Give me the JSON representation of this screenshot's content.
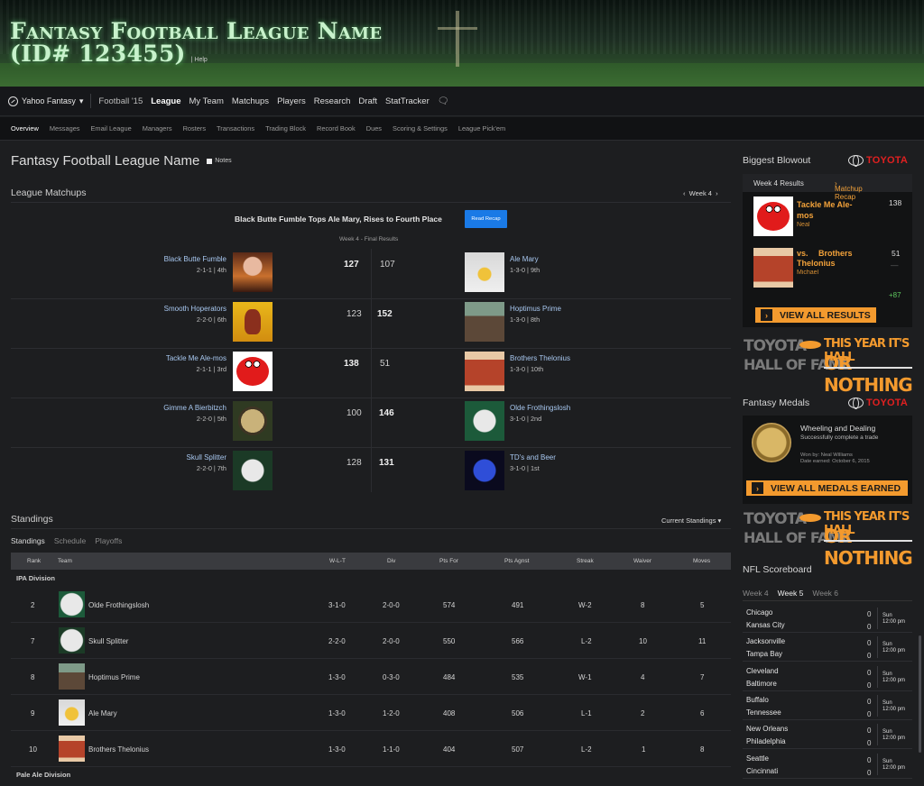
{
  "header": {
    "title_line1": "Fantasy Football League Name",
    "title_line2": "(ID# 123455)",
    "help": "Help"
  },
  "nav": {
    "brand": "Yahoo Fantasy",
    "season": "Football '15",
    "items": [
      "League",
      "My Team",
      "Matchups",
      "Players",
      "Research",
      "Draft",
      "StatTracker"
    ]
  },
  "subnav": [
    "Overview",
    "Messages",
    "Email League",
    "Managers",
    "Rosters",
    "Transactions",
    "Trading Block",
    "Record Book",
    "Dues",
    "Scoring & Settings",
    "League Pick'em"
  ],
  "page": {
    "title": "Fantasy Football League Name",
    "notes": "Notes"
  },
  "matchups": {
    "title": "League Matchups",
    "week": "Week 4",
    "headline": "Black Butte Fumble Tops Ale Mary, Rises to Fourth Place",
    "recap_button": "Read Recap",
    "status": "Week 4 - Final Results",
    "games": [
      {
        "home": {
          "name": "Black Butte Fumble",
          "record": "2-1-1 | 4th",
          "score": "127",
          "win": true
        },
        "away": {
          "name": "Ale Mary",
          "record": "1-3-0 | 9th",
          "score": "107",
          "win": false
        }
      },
      {
        "home": {
          "name": "Smooth Hoperators",
          "record": "2-2-0 | 6th",
          "score": "123",
          "win": false
        },
        "away": {
          "name": "Hoptimus Prime",
          "record": "1-3-0 | 8th",
          "score": "152",
          "win": true
        }
      },
      {
        "home": {
          "name": "Tackle Me Ale-mos",
          "record": "2-1-1 | 3rd",
          "score": "138",
          "win": true
        },
        "away": {
          "name": "Brothers Thelonius",
          "record": "1-3-0 | 10th",
          "score": "51",
          "win": false
        }
      },
      {
        "home": {
          "name": "Gimme A Bierbitzch",
          "record": "2-2-0 | 5th",
          "score": "100",
          "win": false
        },
        "away": {
          "name": "Olde Frothingslosh",
          "record": "3-1-0 | 2nd",
          "score": "146",
          "win": true
        }
      },
      {
        "home": {
          "name": "Skull Splitter",
          "record": "2-2-0 | 7th",
          "score": "128",
          "win": false
        },
        "away": {
          "name": "TD's and Beer",
          "record": "3-1-0 | 1st",
          "score": "131",
          "win": true
        }
      }
    ]
  },
  "standings": {
    "title": "Standings",
    "selector": "Current Standings",
    "tabs": [
      "Standings",
      "Schedule",
      "Playoffs"
    ],
    "columns": [
      "Rank",
      "Team",
      "W-L-T",
      "Div",
      "Pts For",
      "Pts Agnst",
      "Streak",
      "Waiver",
      "Moves"
    ],
    "division1": "IPA Division",
    "division2": "Pale Ale Division",
    "rows": [
      {
        "rank": "2",
        "team": "Olde Frothingslosh",
        "wlt": "3-1-0",
        "div": "2-0-0",
        "pf": "574",
        "pa": "491",
        "streak": "W-2",
        "waiver": "8",
        "moves": "5"
      },
      {
        "rank": "7",
        "team": "Skull Splitter",
        "wlt": "2-2-0",
        "div": "2-0-0",
        "pf": "550",
        "pa": "566",
        "streak": "L-2",
        "waiver": "10",
        "moves": "11"
      },
      {
        "rank": "8",
        "team": "Hoptimus Prime",
        "wlt": "1-3-0",
        "div": "0-3-0",
        "pf": "484",
        "pa": "535",
        "streak": "W-1",
        "waiver": "4",
        "moves": "7"
      },
      {
        "rank": "9",
        "team": "Ale Mary",
        "wlt": "1-3-0",
        "div": "1-2-0",
        "pf": "408",
        "pa": "506",
        "streak": "L-1",
        "waiver": "2",
        "moves": "6"
      },
      {
        "rank": "10",
        "team": "Brothers Thelonius",
        "wlt": "1-3-0",
        "div": "1-1-0",
        "pf": "404",
        "pa": "507",
        "streak": "L-2",
        "waiver": "1",
        "moves": "8"
      }
    ]
  },
  "sidebar": {
    "blowout_title": "Biggest Blowout",
    "sponsor": "TOYOTA",
    "results_label": "Week 4 Results",
    "matchup_recap": "Matchup Recap",
    "winner": {
      "name": "Tackle Me Ale-mos",
      "manager": "Neal",
      "score": "138"
    },
    "vs": "vs.",
    "loser": {
      "name": "Brothers Thelonius",
      "manager": "Michael",
      "score": "51",
      "dash": "—"
    },
    "diff": "+87",
    "view_results": "VIEW ALL RESULTS",
    "ad": {
      "brand1": "TOYOTA",
      "brand2": "HALL OF FAME",
      "tag1": "THIS YEAR IT'S HALL",
      "tag2": "OR NOTHING"
    },
    "medals_title": "Fantasy Medals",
    "medal": {
      "title": "Wheeling and Dealing",
      "desc": "Successfully complete a trade",
      "won_by": "Won by: Neal Williams",
      "earned": "Date earned: October 6, 2015"
    },
    "view_medals": "VIEW ALL MEDALS EARNED",
    "nfl_title": "NFL Scoreboard",
    "nfl_tabs": [
      "Week 4",
      "Week 5",
      "Week 6"
    ],
    "games": [
      {
        "t1": "Chicago",
        "t2": "Kansas City",
        "s1": "0",
        "s2": "0",
        "day": "Sun",
        "time": "12:00 pm"
      },
      {
        "t1": "Jacksonville",
        "t2": "Tampa Bay",
        "s1": "0",
        "s2": "0",
        "day": "Sun",
        "time": "12:00 pm"
      },
      {
        "t1": "Cleveland",
        "t2": "Baltimore",
        "s1": "0",
        "s2": "0",
        "day": "Sun",
        "time": "12:00 pm"
      },
      {
        "t1": "Buffalo",
        "t2": "Tennessee",
        "s1": "0",
        "s2": "0",
        "day": "Sun",
        "time": "12:00 pm"
      },
      {
        "t1": "New Orleans",
        "t2": "Philadelphia",
        "s1": "0",
        "s2": "0",
        "day": "Sun",
        "time": "12:00 pm"
      },
      {
        "t1": "Seattle",
        "t2": "Cincinnati",
        "s1": "0",
        "s2": "0",
        "day": "Sun",
        "time": "12:00 pm"
      }
    ]
  }
}
